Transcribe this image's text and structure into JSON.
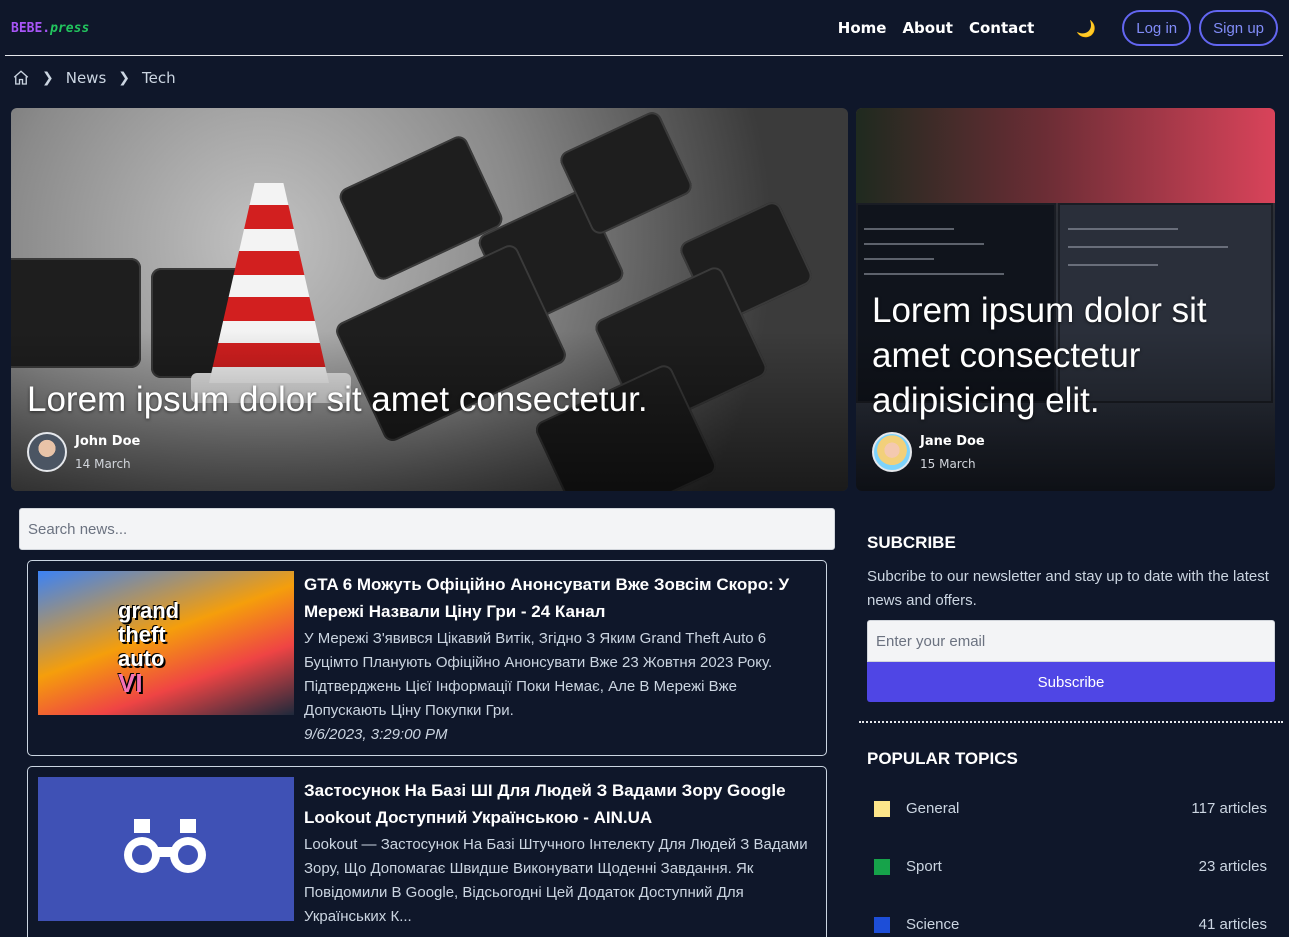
{
  "brand": {
    "logo_main": "BEBE.",
    "logo_accent": "press"
  },
  "nav": {
    "links": [
      "Home",
      "About",
      "Contact"
    ],
    "theme_toggle": "🌙",
    "login": "Log in",
    "signup": "Sign up"
  },
  "breadcrumb": {
    "items": [
      "News",
      "Tech"
    ]
  },
  "featured": [
    {
      "title": "Lorem ipsum dolor sit amet consectetur.",
      "author": "John Doe",
      "date": "14 March"
    },
    {
      "title": "Lorem ipsum dolor sit amet consectetur adipisicing elit.",
      "author": "Jane Doe",
      "date": "15 March"
    }
  ],
  "search": {
    "placeholder": "Search news..."
  },
  "articles": [
    {
      "title": "GTA 6 Можуть Офіційно Анонсувати Вже Зовсім Скоро: У Мережі Назвали Ціну Гри - 24 Канал",
      "description": "У Мережі З'явився Цікавий Витік, Згідно З Яким Grand Theft Auto 6 Буцімто Планують Офіційно Анонсувати Вже 23 Жовтня 2023 Року. Підтверджень Цієї Інформації Поки Немає, Але В Мережі Вже Допускають Ціну Покупки Гри.",
      "time": "9/6/2023, 3:29:00 PM",
      "image_text": [
        "grand",
        "theft",
        "auto",
        "VI"
      ]
    },
    {
      "title": "Застосунок На Базі ШІ Для Людей З Вадами Зору Google Lookout Доступний Українською - AIN.UA",
      "description": "Lookout — Застосунок На Базі Штучного Інтелекту Для Людей З Вадами Зору, Що Допомагає Швидше Виконувати Щоденні Завдання. Як Повідомили В Google, Відсьогодні Цей Додаток Доступний Для Українських К..."
    }
  ],
  "sidebar": {
    "subscribe_heading": "SUBCRIBE",
    "subscribe_text": "Subcribe to our newsletter and stay up to date with the latest news and offers.",
    "email_placeholder": "Enter your email",
    "subscribe_button": "Subscribe",
    "topics_heading": "POPULAR TOPICS",
    "topics": [
      {
        "name": "General",
        "count": "117 articles",
        "color": "#fde68a"
      },
      {
        "name": "Sport",
        "count": "23 articles",
        "color": "#16a34a"
      },
      {
        "name": "Science",
        "count": "41 articles",
        "color": "#1d4ed8"
      }
    ]
  },
  "colors": {
    "background": "#0f172a",
    "accent": "#4f46e5",
    "outline": "#6366f1"
  }
}
